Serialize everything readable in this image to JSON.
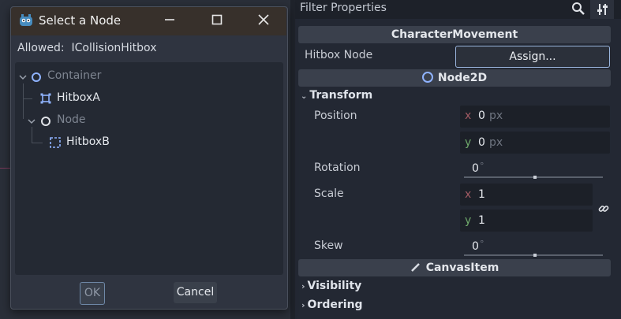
{
  "dialog": {
    "title": "Select a Node",
    "allowed_label": "Allowed:",
    "allowed_value": "ICollisionHitbox",
    "tree": [
      {
        "label": "Container",
        "icon": "circle-node-icon",
        "enabled": false
      },
      {
        "label": "HitboxA",
        "icon": "hitbox-area-icon",
        "enabled": true
      },
      {
        "label": "Node",
        "icon": "circle-node-icon",
        "enabled": false
      },
      {
        "label": "HitboxB",
        "icon": "hitbox-shape-icon",
        "enabled": true
      }
    ],
    "ok_label": "OK",
    "cancel_label": "Cancel"
  },
  "inspector": {
    "filter_placeholder": "Filter Properties",
    "sections": {
      "character_movement": "CharacterMovement",
      "node2d": "Node2D",
      "canvas_item": "CanvasItem"
    },
    "hitbox_node_label": "Hitbox Node",
    "assign_label": "Assign...",
    "transform_label": "Transform",
    "position": {
      "label": "Position",
      "x_axis": "x",
      "x": "0",
      "x_unit": "px",
      "y_axis": "y",
      "y": "0",
      "y_unit": "px"
    },
    "rotation": {
      "label": "Rotation",
      "value": "0",
      "unit": "°"
    },
    "scale": {
      "label": "Scale",
      "x_axis": "x",
      "x": "1",
      "y_axis": "y",
      "y": "1"
    },
    "skew": {
      "label": "Skew",
      "value": "0",
      "unit": "°"
    },
    "visibility_label": "Visibility",
    "ordering_label": "Ordering"
  },
  "colors": {
    "axis_x": "#a15a63",
    "axis_y": "#6ea86a",
    "node2d_icon": "#8fb3ff",
    "accent": "#9ab5dd"
  }
}
